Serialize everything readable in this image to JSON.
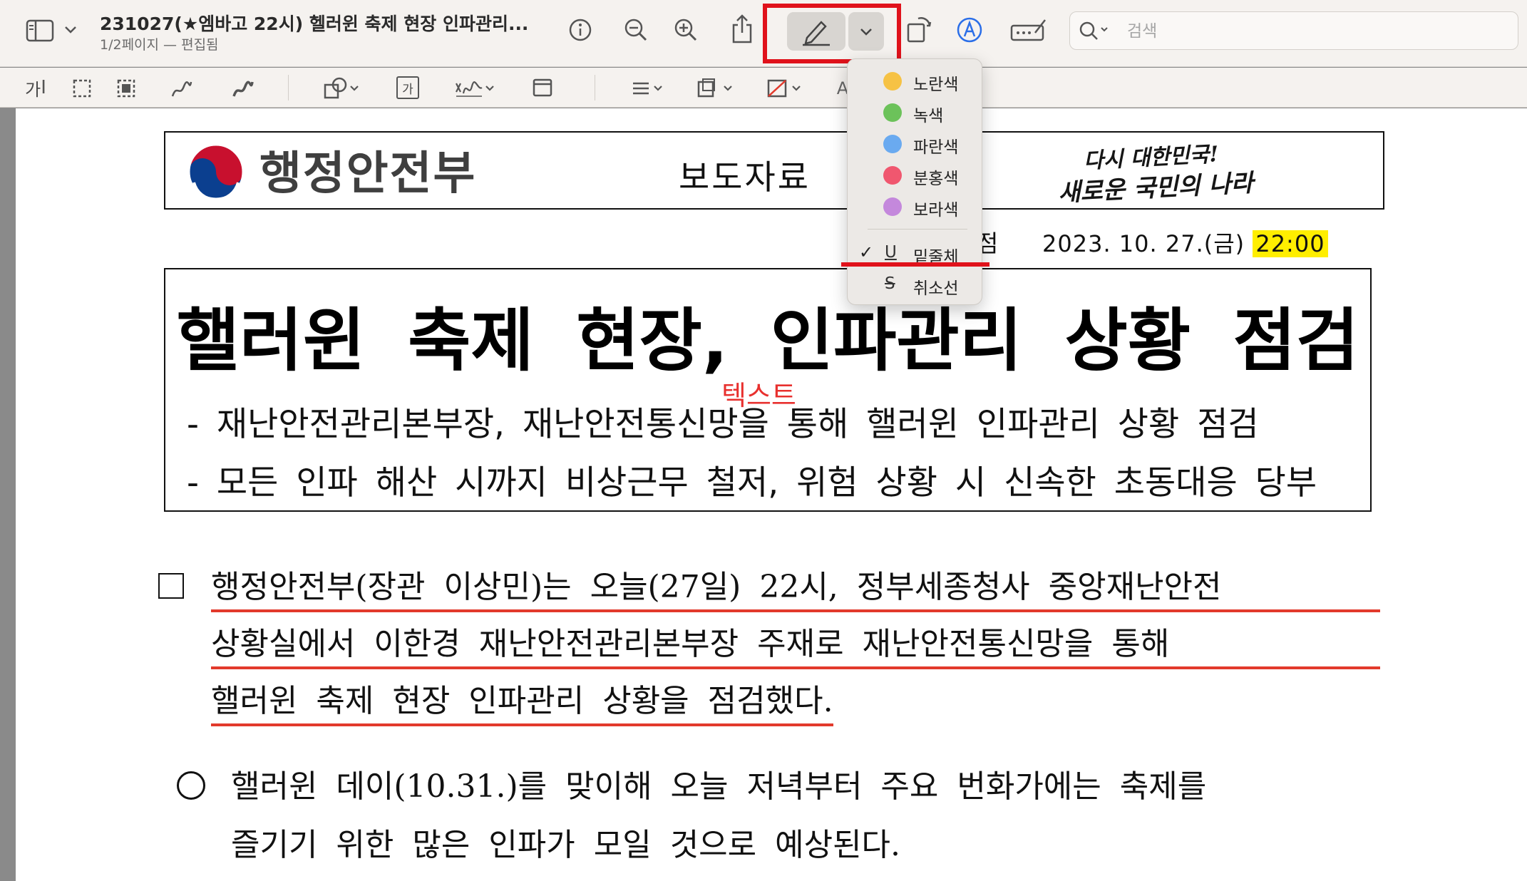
{
  "window": {
    "title": "231027(★엠바고 22시) 헬러윈 축제 현장 인파관리...",
    "subtitle": "1/2페이지 — 편집됨"
  },
  "toolbar": {
    "search_placeholder": "검색",
    "highlight_group_border_color": "#e0121b"
  },
  "markup": {
    "text_tool_label": "가",
    "text_box_label": "가"
  },
  "highlight_menu": {
    "colors": [
      {
        "label": "노란색",
        "color": "#f6c244"
      },
      {
        "label": "녹색",
        "color": "#6cc25a"
      },
      {
        "label": "파란색",
        "color": "#6aaaf0"
      },
      {
        "label": "분홍색",
        "color": "#f0576f"
      },
      {
        "label": "보라색",
        "color": "#c488dc"
      }
    ],
    "styles": [
      {
        "glyph": "U",
        "label": "밑줄체",
        "checked": true
      },
      {
        "glyph": "S",
        "label": "취소선",
        "checked": false
      }
    ]
  },
  "document": {
    "ministry": "행정안전부",
    "press_label": "보도자료",
    "slogan_line1": "다시 대한민국!",
    "slogan_line2": "새로운 국민의 나라",
    "embargo_char": "점",
    "embargo_date": "2023. 10. 27.(금)",
    "embargo_time": "22:00",
    "title": "핼러윈 축제 현장, 인파관리 상황 점검",
    "subtitle1": "- 재난안전관리본부장, 재난안전통신망을 통해 핼러윈 인파관리 상황 점검",
    "subtitle2": "- 모든 인파 해산 시까지 비상근무 철저, 위험 상황 시 신속한 초동대응 당부",
    "text_annotation": "텍스트",
    "annotation_color": "#e8302e",
    "underline_color": "#e23a2c",
    "para1_line1": "행정안전부(장관 이상민)는 오늘(27일) 22시, 정부세종청사 중앙재난안전",
    "para1_line2": "상황실에서 이한경 재난안전관리본부장 주재로 재난안전통신망을 통해",
    "para1_line3": "핼러윈 축제 현장 인파관리 상황을 점검했다.",
    "para2_line1": "핼러윈 데이(10.31.)를 맞이해 오늘 저녁부터 주요 번화가에는 축제를",
    "para2_line2": "즐기기 위한 많은 인파가 모일 것으로 예상된다."
  }
}
